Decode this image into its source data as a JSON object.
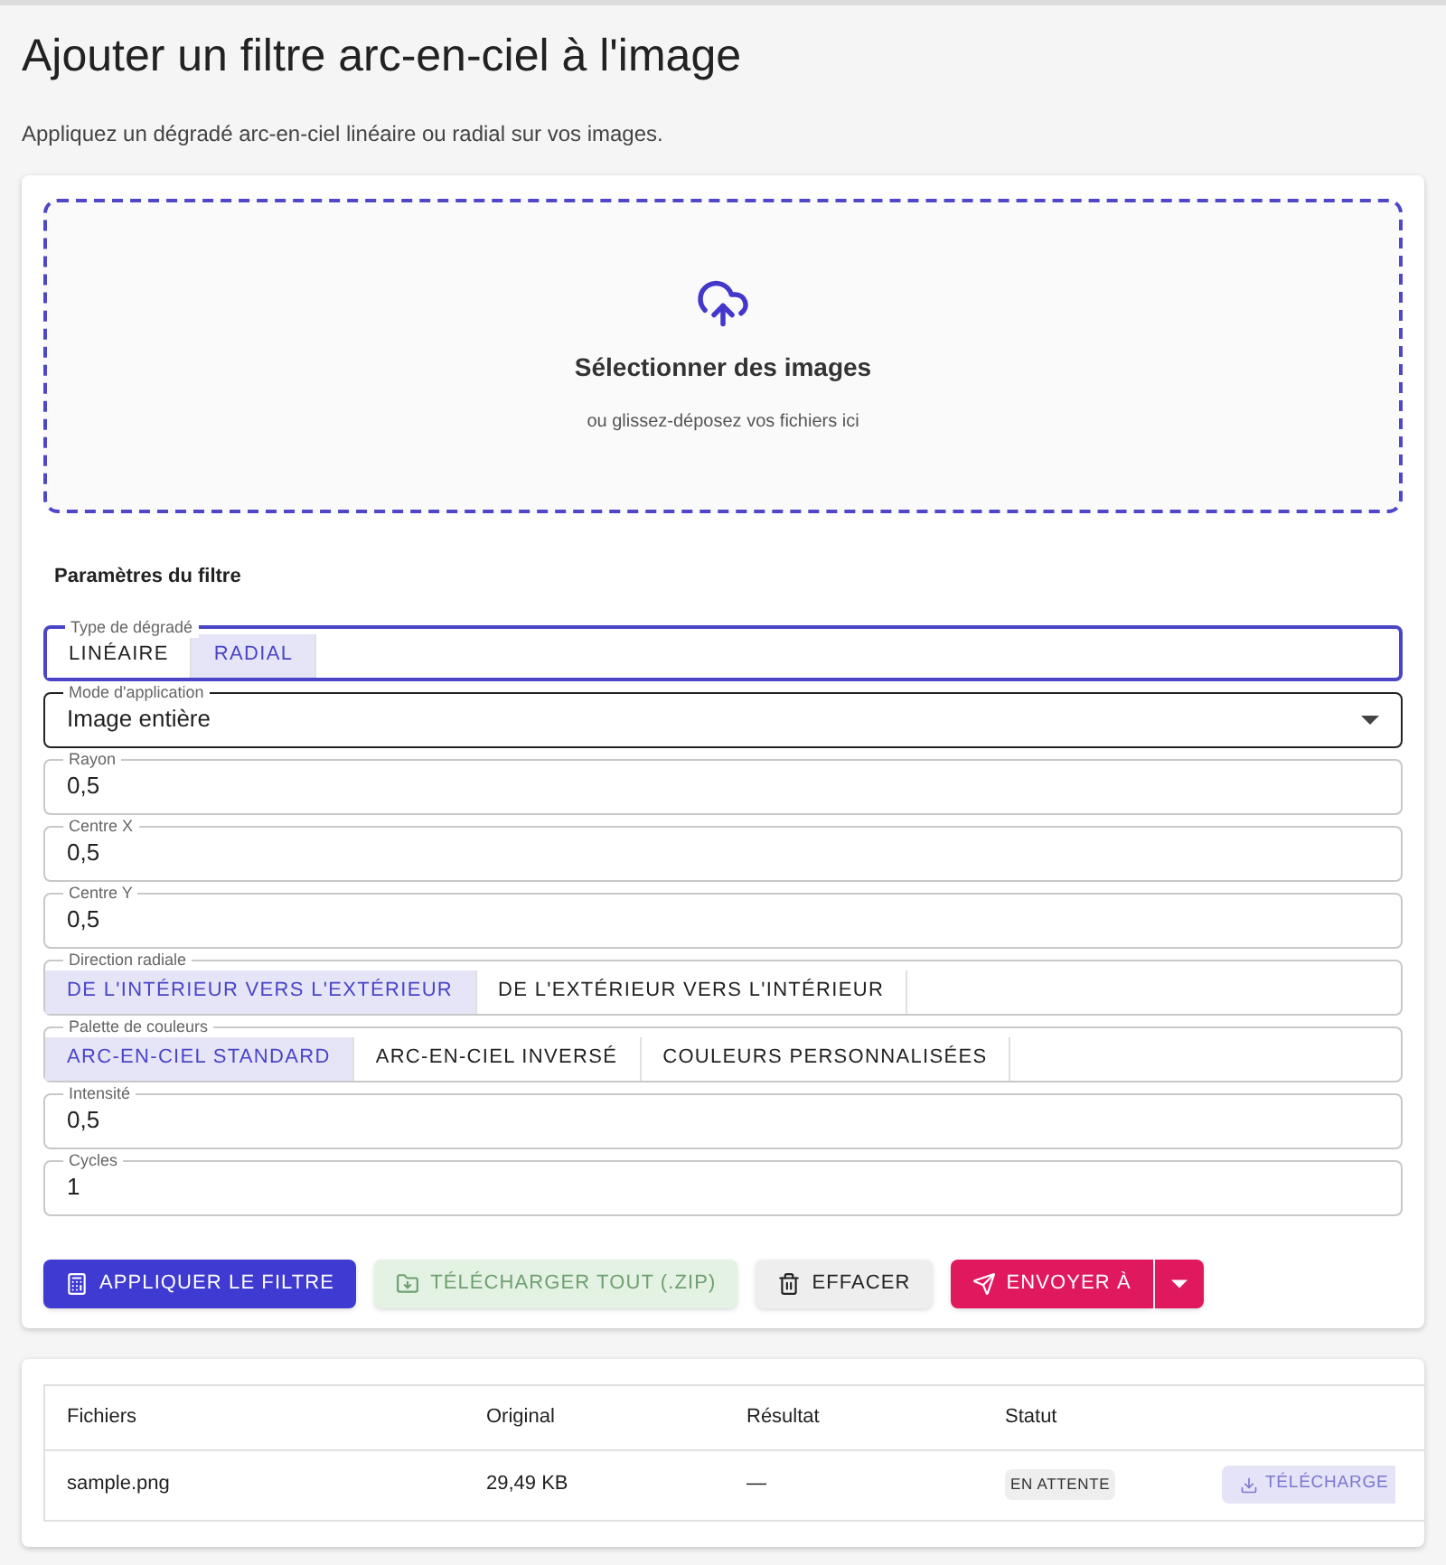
{
  "title": "Ajouter un filtre arc-en-ciel à l'image",
  "subtitle": "Appliquez un dégradé arc-en-ciel linéaire ou radial sur vos images.",
  "dropzone": {
    "title": "Sélectionner des images",
    "hint": "ou glissez-déposez vos fichiers ici"
  },
  "settings": {
    "heading": "Paramètres du filtre",
    "fields": [
      {
        "kind": "toggle",
        "label": "Type de dégradé",
        "focused": true,
        "options": [
          {
            "label": "LINÉAIRE",
            "selected": false
          },
          {
            "label": "RADIAL",
            "selected": true
          }
        ]
      },
      {
        "kind": "select",
        "label": "Mode d'application",
        "focused": false,
        "value": "Image entière"
      },
      {
        "kind": "text",
        "label": "Rayon",
        "focused": false,
        "value": "0,5"
      },
      {
        "kind": "text",
        "label": "Centre X",
        "focused": false,
        "value": "0,5"
      },
      {
        "kind": "text",
        "label": "Centre Y",
        "focused": false,
        "value": "0,5"
      },
      {
        "kind": "toggle",
        "label": "Direction radiale",
        "focused": false,
        "options": [
          {
            "label": "DE L'INTÉRIEUR VERS L'EXTÉRIEUR",
            "selected": true
          },
          {
            "label": "DE L'EXTÉRIEUR VERS L'INTÉRIEUR",
            "selected": false
          }
        ]
      },
      {
        "kind": "toggle",
        "label": "Palette de couleurs",
        "focused": false,
        "options": [
          {
            "label": "ARC-EN-CIEL STANDARD",
            "selected": true
          },
          {
            "label": "ARC-EN-CIEL INVERSÉ",
            "selected": false
          },
          {
            "label": "COULEURS PERSONNALISÉES",
            "selected": false
          }
        ]
      },
      {
        "kind": "text",
        "label": "Intensité",
        "focused": false,
        "value": "0,5"
      },
      {
        "kind": "text",
        "label": "Cycles",
        "focused": false,
        "value": "1"
      }
    ]
  },
  "actions": [
    {
      "kind": "apply",
      "label": "APPLIQUER LE FILTRE",
      "disabled": false
    },
    {
      "kind": "download",
      "label": "TÉLÉCHARGER TOUT (.ZIP)",
      "disabled": true
    },
    {
      "kind": "clear",
      "label": "EFFACER",
      "disabled": false
    },
    {
      "kind": "send",
      "label": "ENVOYER À",
      "disabled": false
    }
  ],
  "table": {
    "columns": [
      "Fichiers",
      "Original",
      "Résultat",
      "Statut"
    ],
    "rows": [
      {
        "file": "sample.png",
        "original": "29,49 KB",
        "result": "—",
        "status": "EN ATTENTE",
        "action": {
          "label": "TÉLÉCHARGE",
          "disabled": true
        }
      }
    ]
  }
}
